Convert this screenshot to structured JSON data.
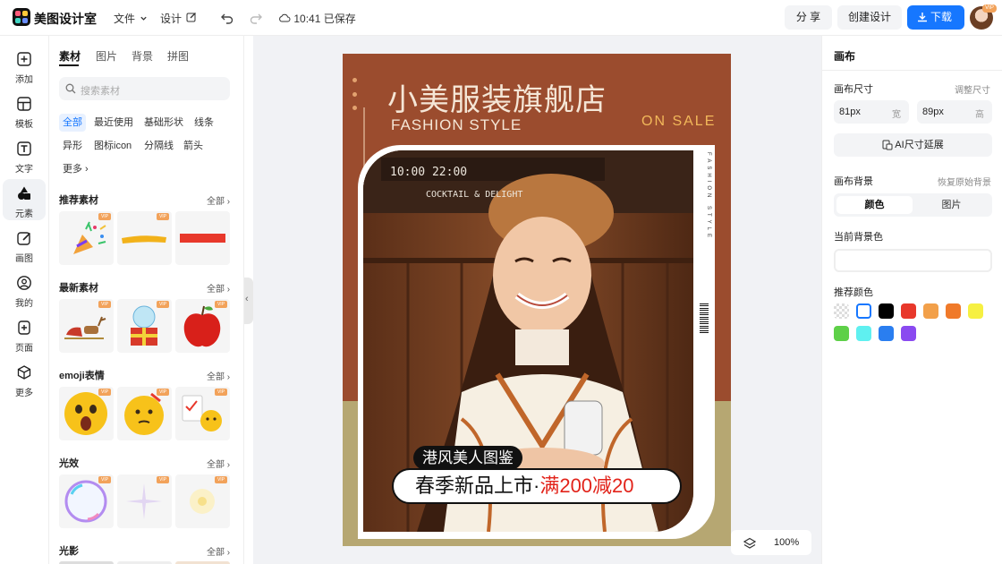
{
  "app": {
    "name": "美图设计室"
  },
  "topbar": {
    "file_menu": "文件",
    "design_menu": "设计",
    "save_status": "10:41 已保存",
    "share": "分 享",
    "create": "创建设计",
    "download": "下载",
    "avatar_badge": "VIP"
  },
  "rail": [
    {
      "label": "添加",
      "icon": "plus-square-icon"
    },
    {
      "label": "模板",
      "icon": "template-icon"
    },
    {
      "label": "文字",
      "icon": "text-icon"
    },
    {
      "label": "元素",
      "icon": "shapes-icon",
      "active": true
    },
    {
      "label": "画图",
      "icon": "pencil-icon"
    },
    {
      "label": "我的",
      "icon": "user-icon"
    },
    {
      "label": "页面",
      "icon": "page-add-icon"
    },
    {
      "label": "更多",
      "icon": "cube-icon"
    }
  ],
  "panel": {
    "tabs": [
      "素材",
      "图片",
      "背景",
      "拼图"
    ],
    "search_placeholder": "搜索素材",
    "chips": [
      "全部",
      "最近使用",
      "基础形状",
      "线条",
      "异形",
      "图标icon",
      "分隔线",
      "箭头",
      "更多"
    ],
    "all_label": "全部",
    "vip_badge": "VIP",
    "sections": [
      "推荐素材",
      "最新素材",
      "emoji表情",
      "光效",
      "光影"
    ]
  },
  "poster": {
    "title": "小美服装旗舰店",
    "subtitle": "FASHION STYLE",
    "sale": "ON SALE",
    "vertical_text": "FASHION STYLE",
    "caption_small": "港风美人图鉴",
    "caption_big": "春季新品上市·",
    "caption_promo": "满200减20",
    "sign_text": "10:00 22:00",
    "sign_text2": "COCKTAIL & DELIGHT"
  },
  "zoom": {
    "level": "100%"
  },
  "rpanel": {
    "title": "画布",
    "size_label": "画布尺寸",
    "resize_link": "调整尺寸",
    "width_value": "81px",
    "width_unit": "宽",
    "height_value": "89px",
    "height_unit": "高",
    "ai_extend": "AI尺寸延展",
    "bg_label": "画布背景",
    "restore_link": "恢复原始背景",
    "seg_color": "颜色",
    "seg_image": "图片",
    "current_bg_label": "当前背景色",
    "recommend_label": "推荐颜色",
    "swatches": [
      "transparent",
      "#ffffff",
      "#000000",
      "#e8382b",
      "#f2a04a",
      "#f07a2a",
      "#f6f042",
      "#5ed048",
      "#5ff0f0",
      "#2a7ef0",
      "#8a4af0"
    ]
  },
  "colors": {
    "accent": "#1677ff",
    "poster_brown": "#9b4c2e",
    "poster_olive": "#b6a772",
    "promo_red": "#e2231a"
  }
}
